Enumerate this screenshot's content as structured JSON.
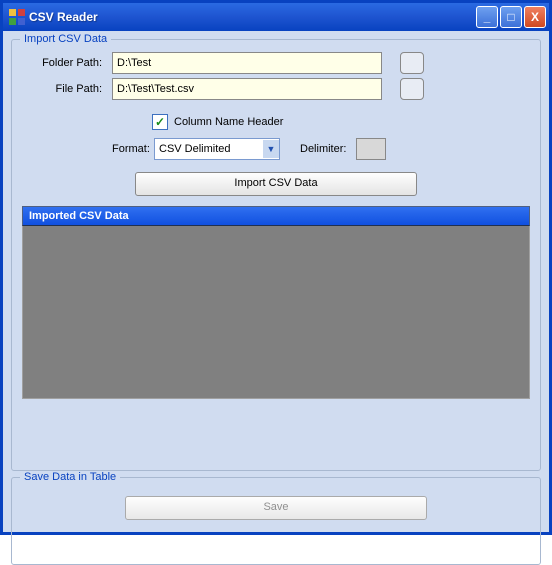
{
  "titlebar": {
    "title": "CSV Reader"
  },
  "controls": {
    "minimize": "_",
    "maximize": "□",
    "close": "X"
  },
  "import_group": {
    "legend": "Import CSV Data",
    "folder_label": "Folder Path:",
    "folder_value": "D:\\Test",
    "file_label": "File Path:",
    "file_value": "D:\\Test\\Test.csv",
    "checkbox_label": "Column Name Header",
    "checkbox_checked": "✓",
    "format_label": "Format:",
    "format_value": "CSV Delimited",
    "delimiter_label": "Delimiter:",
    "delimiter_value": "",
    "import_button": "Import CSV Data",
    "grid_caption": "Imported CSV Data"
  },
  "save_group": {
    "legend": "Save Data in Table",
    "save_button": "Save"
  }
}
